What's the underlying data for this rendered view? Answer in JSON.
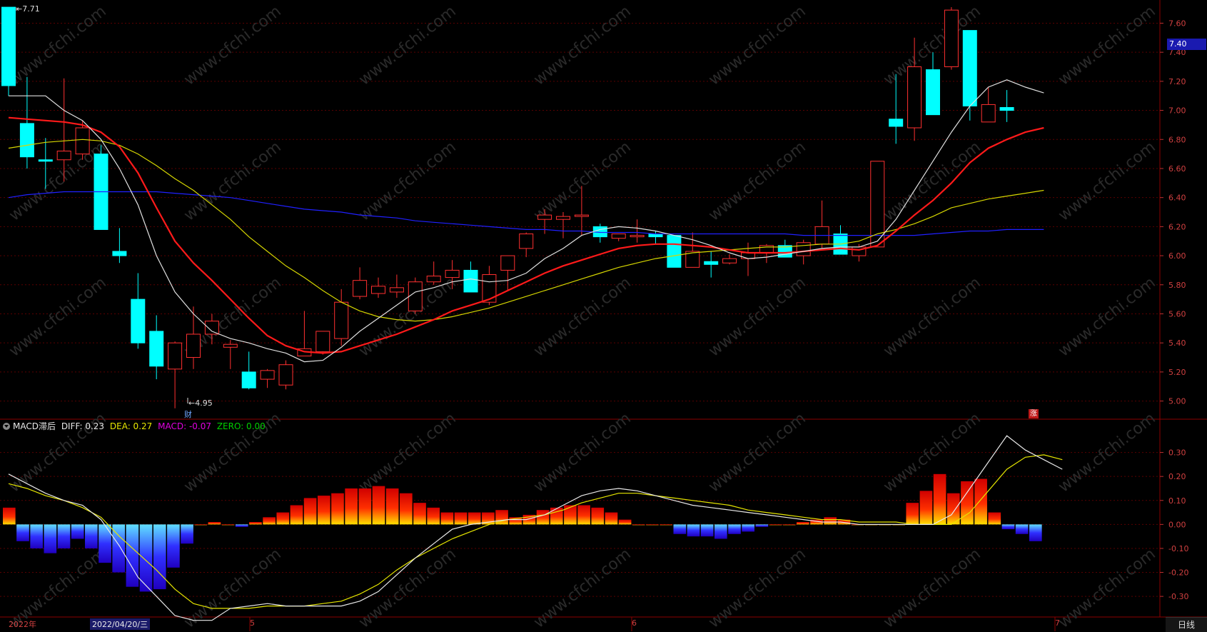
{
  "candles": [
    {
      "o": 7.71,
      "h": 7.71,
      "l": 7.1,
      "c": 7.17
    },
    {
      "o": 6.91,
      "h": 7.23,
      "l": 6.6,
      "c": 6.68
    },
    {
      "o": 6.66,
      "h": 6.81,
      "l": 6.46,
      "c": 6.65
    },
    {
      "o": 6.66,
      "h": 7.22,
      "l": 6.51,
      "c": 6.72
    },
    {
      "o": 6.7,
      "h": 6.93,
      "l": 6.66,
      "c": 6.88
    },
    {
      "o": 6.7,
      "h": 6.76,
      "l": 6.18,
      "c": 6.18
    },
    {
      "o": 6.03,
      "h": 6.19,
      "l": 5.95,
      "c": 6.0
    },
    {
      "o": 5.7,
      "h": 5.88,
      "l": 5.36,
      "c": 5.4
    },
    {
      "o": 5.48,
      "h": 5.59,
      "l": 5.15,
      "c": 5.24
    },
    {
      "o": 5.22,
      "h": 5.41,
      "l": 4.95,
      "c": 5.4
    },
    {
      "o": 5.3,
      "h": 5.65,
      "l": 5.22,
      "c": 5.46
    },
    {
      "o": 5.46,
      "h": 5.6,
      "l": 5.39,
      "c": 5.55
    },
    {
      "o": 5.37,
      "h": 5.42,
      "l": 5.22,
      "c": 5.39
    },
    {
      "o": 5.2,
      "h": 5.34,
      "l": 5.08,
      "c": 5.09
    },
    {
      "o": 5.15,
      "h": 5.22,
      "l": 5.09,
      "c": 5.21
    },
    {
      "o": 5.11,
      "h": 5.28,
      "l": 5.08,
      "c": 5.25
    },
    {
      "o": 5.31,
      "h": 5.62,
      "l": 5.31,
      "c": 5.36
    },
    {
      "o": 5.34,
      "h": 5.43,
      "l": 5.32,
      "c": 5.48
    },
    {
      "o": 5.43,
      "h": 5.77,
      "l": 5.38,
      "c": 5.68
    },
    {
      "o": 5.72,
      "h": 5.92,
      "l": 5.7,
      "c": 5.83
    },
    {
      "o": 5.74,
      "h": 5.85,
      "l": 5.71,
      "c": 5.79
    },
    {
      "o": 5.75,
      "h": 5.87,
      "l": 5.71,
      "c": 5.78
    },
    {
      "o": 5.62,
      "h": 5.85,
      "l": 5.6,
      "c": 5.82
    },
    {
      "o": 5.82,
      "h": 5.96,
      "l": 5.8,
      "c": 5.86
    },
    {
      "o": 5.85,
      "h": 5.97,
      "l": 5.77,
      "c": 5.9
    },
    {
      "o": 5.9,
      "h": 5.96,
      "l": 5.8,
      "c": 5.75
    },
    {
      "o": 5.68,
      "h": 5.93,
      "l": 5.66,
      "c": 5.87
    },
    {
      "o": 5.9,
      "h": 6.0,
      "l": 5.76,
      "c": 6.0
    },
    {
      "o": 6.05,
      "h": 6.16,
      "l": 5.99,
      "c": 6.15
    },
    {
      "o": 6.25,
      "h": 6.32,
      "l": 6.15,
      "c": 6.28
    },
    {
      "o": 6.25,
      "h": 6.3,
      "l": 6.12,
      "c": 6.27
    },
    {
      "o": 6.28,
      "h": 6.48,
      "l": 6.14,
      "c": 6.28
    },
    {
      "o": 6.2,
      "h": 6.22,
      "l": 6.09,
      "c": 6.13
    },
    {
      "o": 6.12,
      "h": 6.15,
      "l": 6.1,
      "c": 6.15
    },
    {
      "o": 6.14,
      "h": 6.25,
      "l": 6.09,
      "c": 6.14
    },
    {
      "o": 6.15,
      "h": 6.17,
      "l": 6.08,
      "c": 6.13
    },
    {
      "o": 6.14,
      "h": 6.14,
      "l": 6.01,
      "c": 5.92
    },
    {
      "o": 5.92,
      "h": 6.16,
      "l": 5.92,
      "c": 6.03
    },
    {
      "o": 5.96,
      "h": 6.03,
      "l": 5.85,
      "c": 5.94
    },
    {
      "o": 5.95,
      "h": 6.01,
      "l": 5.94,
      "c": 5.98
    },
    {
      "o": 5.98,
      "h": 6.09,
      "l": 5.86,
      "c": 6.02
    },
    {
      "o": 6.02,
      "h": 6.08,
      "l": 5.95,
      "c": 6.07
    },
    {
      "o": 6.07,
      "h": 6.11,
      "l": 6.0,
      "c": 5.99
    },
    {
      "o": 6.0,
      "h": 6.11,
      "l": 5.94,
      "c": 6.09
    },
    {
      "o": 6.08,
      "h": 6.38,
      "l": 6.05,
      "c": 6.2
    },
    {
      "o": 6.15,
      "h": 6.21,
      "l": 6.02,
      "c": 6.01
    },
    {
      "o": 6.0,
      "h": 6.08,
      "l": 5.96,
      "c": 6.06
    },
    {
      "o": 6.06,
      "h": 6.65,
      "l": 6.06,
      "c": 6.65
    },
    {
      "o": 6.94,
      "h": 7.25,
      "l": 6.77,
      "c": 6.89
    },
    {
      "o": 6.88,
      "h": 7.5,
      "l": 6.79,
      "c": 7.3
    },
    {
      "o": 7.28,
      "h": 7.4,
      "l": 6.99,
      "c": 6.97
    },
    {
      "o": 7.3,
      "h": 7.71,
      "l": 7.28,
      "c": 7.69
    },
    {
      "o": 7.55,
      "h": 7.55,
      "l": 6.93,
      "c": 7.03
    },
    {
      "o": 6.92,
      "h": 7.16,
      "l": 6.92,
      "c": 7.04
    },
    {
      "o": 7.02,
      "h": 7.14,
      "l": 6.92,
      "c": 7.0
    }
  ],
  "macd": {
    "diff": 0.23,
    "dea": 0.27,
    "hist": -0.07,
    "series_diff": [
      0.21,
      0.17,
      0.13,
      0.1,
      0.08,
      0.02,
      -0.09,
      -0.22,
      -0.3,
      -0.38,
      -0.4,
      -0.4,
      -0.35,
      -0.34,
      -0.33,
      -0.34,
      -0.34,
      -0.34,
      -0.34,
      -0.32,
      -0.28,
      -0.21,
      -0.14,
      -0.08,
      -0.02,
      0.0,
      0.01,
      0.02,
      0.02,
      0.04,
      0.08,
      0.12,
      0.14,
      0.15,
      0.14,
      0.12,
      0.1,
      0.08,
      0.07,
      0.06,
      0.05,
      0.04,
      0.03,
      0.02,
      0.01,
      0.01,
      0.0,
      0.0,
      0.0,
      0.0,
      0.0,
      0.04,
      0.15,
      0.26,
      0.37,
      0.31,
      0.27,
      0.23
    ],
    "series_dea": [
      0.17,
      0.15,
      0.12,
      0.1,
      0.07,
      0.03,
      -0.05,
      -0.12,
      -0.19,
      -0.27,
      -0.33,
      -0.35,
      -0.35,
      -0.35,
      -0.34,
      -0.34,
      -0.34,
      -0.33,
      -0.32,
      -0.29,
      -0.25,
      -0.19,
      -0.14,
      -0.1,
      -0.06,
      -0.03,
      0.0,
      0.02,
      0.03,
      0.04,
      0.06,
      0.09,
      0.11,
      0.13,
      0.13,
      0.12,
      0.11,
      0.1,
      0.09,
      0.08,
      0.06,
      0.05,
      0.04,
      0.03,
      0.02,
      0.02,
      0.01,
      0.01,
      0.01,
      0.0,
      0.0,
      0.0,
      0.05,
      0.14,
      0.23,
      0.28,
      0.29,
      0.27
    ],
    "histogram": [
      0.07,
      -0.07,
      -0.1,
      -0.12,
      -0.1,
      -0.06,
      -0.1,
      -0.16,
      -0.2,
      -0.26,
      -0.28,
      -0.27,
      -0.18,
      -0.08,
      0.0,
      0.01,
      0.0,
      -0.01,
      0.01,
      0.03,
      0.05,
      0.08,
      0.11,
      0.12,
      0.13,
      0.15,
      0.15,
      0.16,
      0.15,
      0.13,
      0.09,
      0.07,
      0.05,
      0.05,
      0.05,
      0.05,
      0.06,
      0.03,
      0.04,
      0.06,
      0.07,
      0.08,
      0.08,
      0.07,
      0.05,
      0.02,
      0.0,
      0.0,
      0.0,
      -0.04,
      -0.05,
      -0.05,
      -0.06,
      -0.04,
      -0.03,
      -0.01,
      0.0,
      0.0,
      0.01,
      0.02,
      0.03,
      0.02,
      0.0,
      0.0,
      0.0,
      0.0,
      0.09,
      0.14,
      0.21,
      0.13,
      0.18,
      0.19,
      0.05,
      -0.02,
      -0.04,
      -0.07
    ]
  },
  "ma_lines": {
    "ma5_white": [
      7.1,
      7.1,
      7.1,
      7.0,
      6.93,
      6.8,
      6.6,
      6.35,
      6.0,
      5.75,
      5.6,
      5.48,
      5.43,
      5.4,
      5.36,
      5.33,
      5.27,
      5.28,
      5.37,
      5.48,
      5.57,
      5.66,
      5.75,
      5.78,
      5.82,
      5.84,
      5.82,
      5.83,
      5.88,
      5.98,
      6.05,
      6.14,
      6.18,
      6.2,
      6.19,
      6.17,
      6.14,
      6.11,
      6.07,
      6.02,
      5.98,
      5.99,
      6.01,
      6.03,
      6.05,
      6.06,
      6.06,
      6.1,
      6.25,
      6.45,
      6.65,
      6.85,
      7.03,
      7.16,
      7.21,
      7.16,
      7.12
    ],
    "ma10_red": [
      6.95,
      6.94,
      6.93,
      6.92,
      6.9,
      6.85,
      6.75,
      6.57,
      6.33,
      6.1,
      5.95,
      5.83,
      5.7,
      5.57,
      5.45,
      5.38,
      5.34,
      5.33,
      5.34,
      5.38,
      5.42,
      5.46,
      5.51,
      5.56,
      5.62,
      5.66,
      5.7,
      5.76,
      5.82,
      5.88,
      5.93,
      5.97,
      6.01,
      6.05,
      6.07,
      6.08,
      6.08,
      6.07,
      6.06,
      6.04,
      6.02,
      6.02,
      6.02,
      6.03,
      6.04,
      6.05,
      6.04,
      6.07,
      6.17,
      6.28,
      6.38,
      6.5,
      6.64,
      6.74,
      6.8,
      6.85,
      6.88
    ],
    "ma20_yellow": [
      6.74,
      6.76,
      6.78,
      6.79,
      6.8,
      6.79,
      6.76,
      6.7,
      6.62,
      6.53,
      6.45,
      6.35,
      6.25,
      6.13,
      6.03,
      5.93,
      5.85,
      5.76,
      5.68,
      5.62,
      5.58,
      5.56,
      5.55,
      5.56,
      5.58,
      5.61,
      5.64,
      5.68,
      5.72,
      5.76,
      5.8,
      5.84,
      5.88,
      5.92,
      5.95,
      5.98,
      6.0,
      6.02,
      6.03,
      6.04,
      6.05,
      6.06,
      6.06,
      6.07,
      6.08,
      6.08,
      6.1,
      6.15,
      6.18,
      6.22,
      6.27,
      6.33,
      6.36,
      6.39,
      6.41,
      6.43,
      6.45
    ],
    "ma60_blue": [
      6.4,
      6.42,
      6.43,
      6.44,
      6.44,
      6.44,
      6.44,
      6.44,
      6.44,
      6.43,
      6.42,
      6.41,
      6.4,
      6.38,
      6.36,
      6.34,
      6.32,
      6.31,
      6.3,
      6.28,
      6.27,
      6.26,
      6.24,
      6.23,
      6.22,
      6.21,
      6.2,
      6.19,
      6.18,
      6.18,
      6.17,
      6.17,
      6.16,
      6.16,
      6.16,
      6.15,
      6.15,
      6.15,
      6.15,
      6.15,
      6.15,
      6.15,
      6.15,
      6.14,
      6.14,
      6.14,
      6.14,
      6.14,
      6.14,
      6.14,
      6.15,
      6.16,
      6.17,
      6.17,
      6.18,
      6.18,
      6.18
    ]
  },
  "price_axis": [
    "7.60",
    "7.40",
    "7.20",
    "7.00",
    "6.80",
    "6.60",
    "6.40",
    "6.20",
    "6.00",
    "5.80",
    "5.60",
    "5.40",
    "5.20",
    "5.00"
  ],
  "price_tag": "7.40",
  "macd_axis": [
    "0.30",
    "0.20",
    "0.10",
    "0.00",
    "-0.10",
    "-0.20",
    "-0.30"
  ],
  "header": {
    "title": "MACD滞后",
    "diff_label": "DIFF: 0.23",
    "dea_label": "DEA: 0.27",
    "macd_label": "MACD: -0.07",
    "zero_label": "ZERO: 0.00"
  },
  "annotations": {
    "high": "7.71",
    "low": "←4.95",
    "cai": "财",
    "zhang": "涨"
  },
  "dates": {
    "year": "2022年",
    "selected": "2022/04/20/三",
    "m5": "5",
    "m6": "6",
    "m7": "7"
  },
  "period": "日线",
  "watermark": "www.cfchi.com",
  "colors": {
    "up": "#ff3030",
    "down": "#00ffff",
    "ma5": "#e0e0e0",
    "ma10": "#ff1a1a",
    "ma20": "#d6d600",
    "ma60": "#2020ff",
    "grid": "#5a0000"
  }
}
